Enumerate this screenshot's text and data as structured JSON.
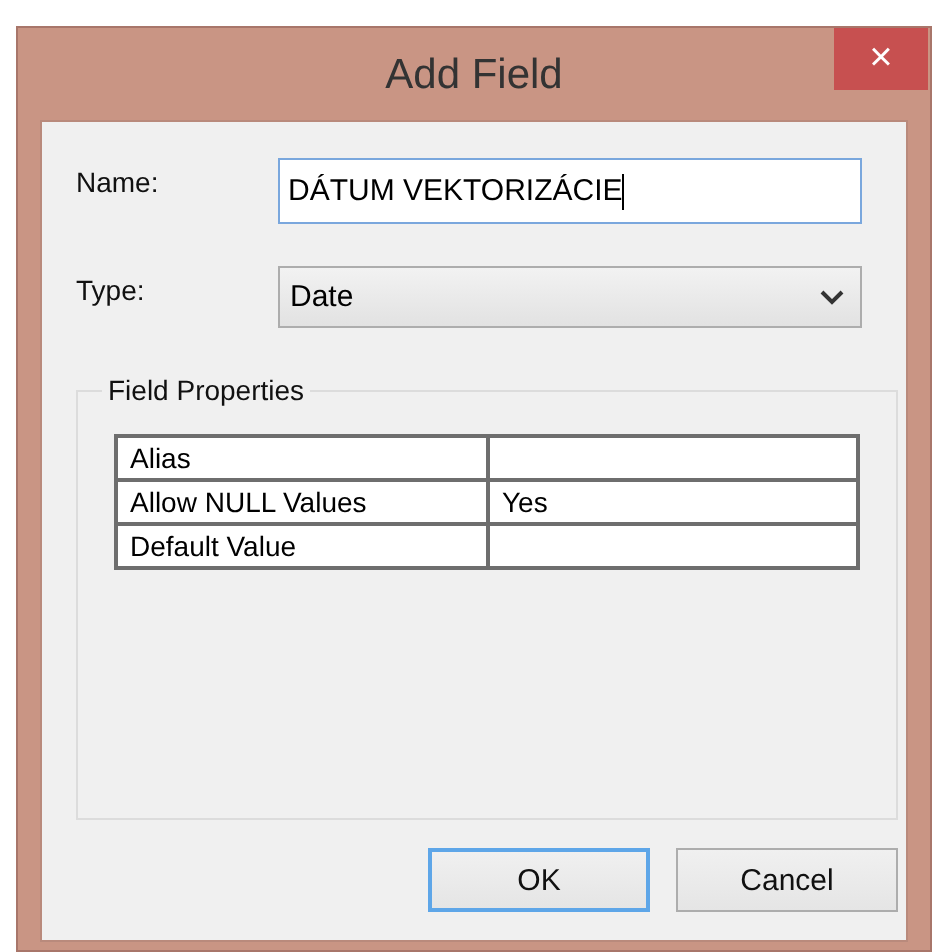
{
  "window": {
    "title": "Add Field",
    "close": "×"
  },
  "fields": [
    {
      "kind": "text",
      "label": "Name:",
      "value": "DÁTUM VEKTORIZÁCIE"
    },
    {
      "kind": "select",
      "label": "Type:",
      "value": "Date"
    }
  ],
  "group": {
    "title": "Field Properties",
    "rows": [
      {
        "property": "Alias",
        "value": ""
      },
      {
        "property": "Allow NULL Values",
        "value": "Yes"
      },
      {
        "property": "Default Value",
        "value": ""
      }
    ]
  },
  "buttons": [
    {
      "label": "OK",
      "default": true
    },
    {
      "label": "Cancel",
      "default": false
    }
  ]
}
